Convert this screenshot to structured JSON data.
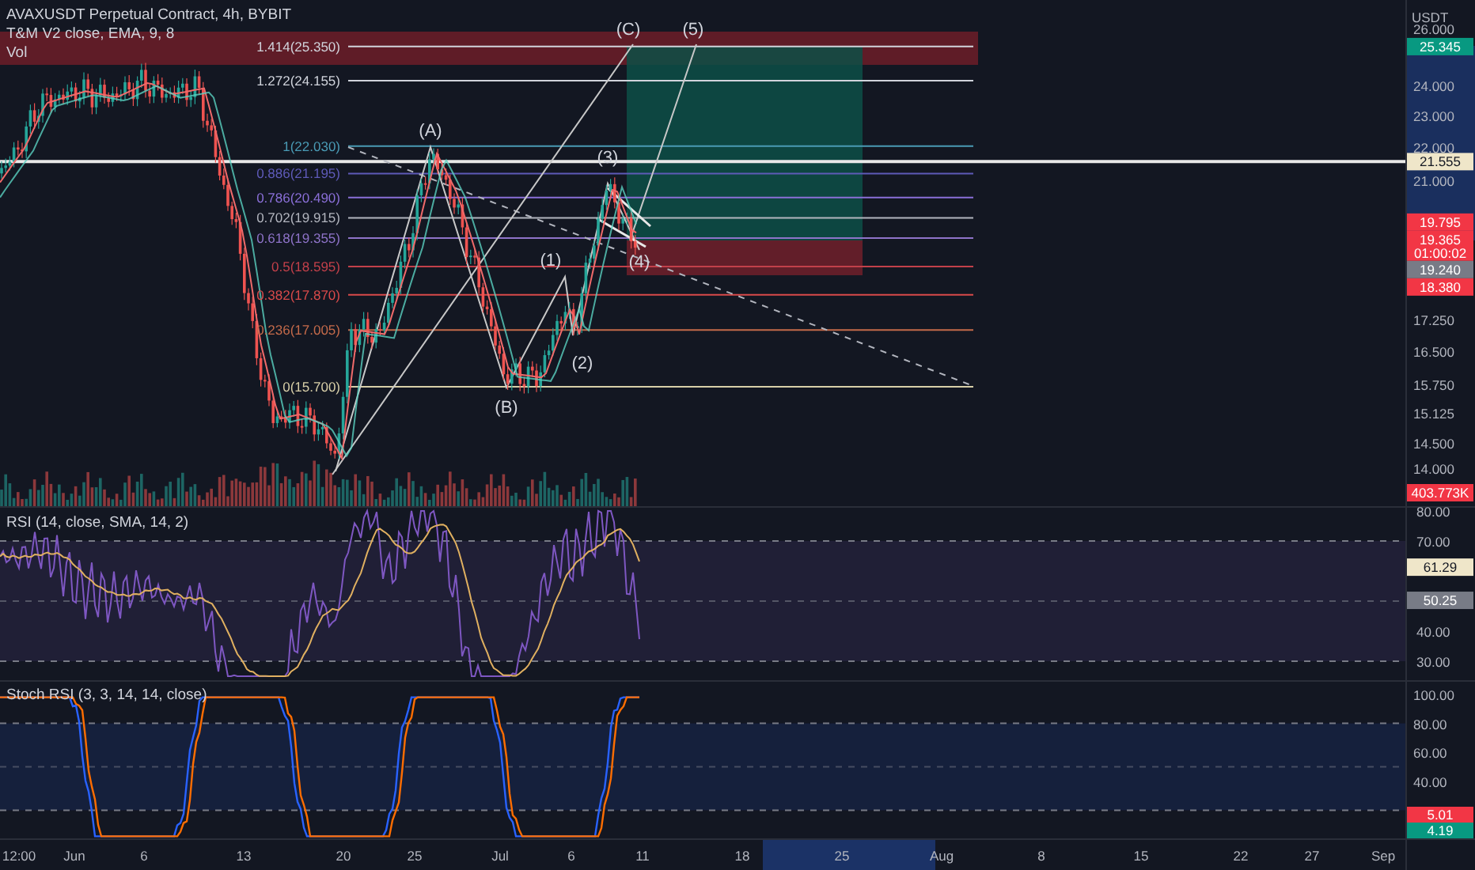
{
  "header": {
    "symbol": "AVAXUSDT Perpetual Contract, 4h, BYBIT",
    "indicator": "T&M V2 close, EMA, 9, 8",
    "volume": "Vol"
  },
  "main_pane": {
    "currency": "USDT",
    "price_ticks": [
      "26.000",
      "24.000",
      "23.000",
      "22.000",
      "21.000",
      "17.250",
      "16.500",
      "15.750",
      "15.125",
      "14.500",
      "14.000"
    ],
    "fib_levels": [
      {
        "label": "1.414(25.350)",
        "color": "#d1d4dc"
      },
      {
        "label": "1.272(24.155)",
        "color": "#d1d4dc"
      },
      {
        "label": "1(22.030)",
        "color": "#4a9bb5"
      },
      {
        "label": "0.886(21.195)",
        "color": "#5e5ab8"
      },
      {
        "label": "0.786(20.490)",
        "color": "#8a6fd8"
      },
      {
        "label": "0.702(19.915)",
        "color": "#b2b5be"
      },
      {
        "label": "0.618(19.355)",
        "color": "#8e73c9"
      },
      {
        "label": "0.5(18.595)",
        "color": "#c2404a"
      },
      {
        "label": "0.382(17.870)",
        "color": "#d94a4a"
      },
      {
        "label": "0.236(17.005)",
        "color": "#c46a4a"
      },
      {
        "label": "0(15.700)",
        "color": "#d8cfa8"
      }
    ],
    "wave_labels": [
      "(A)",
      "(B)",
      "(1)",
      "(2)",
      "(3)",
      "(4)",
      "(C)",
      "(5)"
    ],
    "price_tags": [
      {
        "kind": "price",
        "label": "25.345",
        "color": "#089981"
      },
      {
        "kind": "price",
        "label": "21.555",
        "color": "#efe6c9"
      },
      {
        "kind": "price",
        "label": "19.795",
        "color": "#f23645"
      },
      {
        "kind": "price",
        "label": "19.365",
        "sublabel": "01:00:02",
        "color": "#f23645"
      },
      {
        "kind": "price",
        "label": "19.240",
        "color": "#787b86"
      },
      {
        "kind": "price",
        "label": "18.380",
        "color": "#f23645"
      },
      {
        "kind": "volume",
        "label": "403.773K",
        "color": "#f23645"
      }
    ]
  },
  "rsi_pane": {
    "title": "RSI (14, close, SMA, 14, 2)",
    "ticks": [
      "80.00",
      "70.00",
      "40.00",
      "30.00"
    ],
    "tags": [
      {
        "label": "61.29",
        "color": "#efe6c9"
      },
      {
        "label": "50.25",
        "color": "#787b86"
      }
    ]
  },
  "stoch_pane": {
    "title": "Stoch RSI (3, 3, 14, 14, close)",
    "ticks": [
      "100.00",
      "80.00",
      "60.00",
      "40.00"
    ],
    "tags": [
      {
        "label": "5.01",
        "color": "#f23645"
      },
      {
        "label": "4.19",
        "color": "#089981"
      }
    ]
  },
  "time_axis": {
    "labels": [
      "12:00",
      "Jun",
      "6",
      "13",
      "20",
      "25",
      "Jul",
      "6",
      "11",
      "18",
      "25",
      "Aug",
      "8",
      "15",
      "22",
      "27",
      "Sep"
    ]
  }
}
